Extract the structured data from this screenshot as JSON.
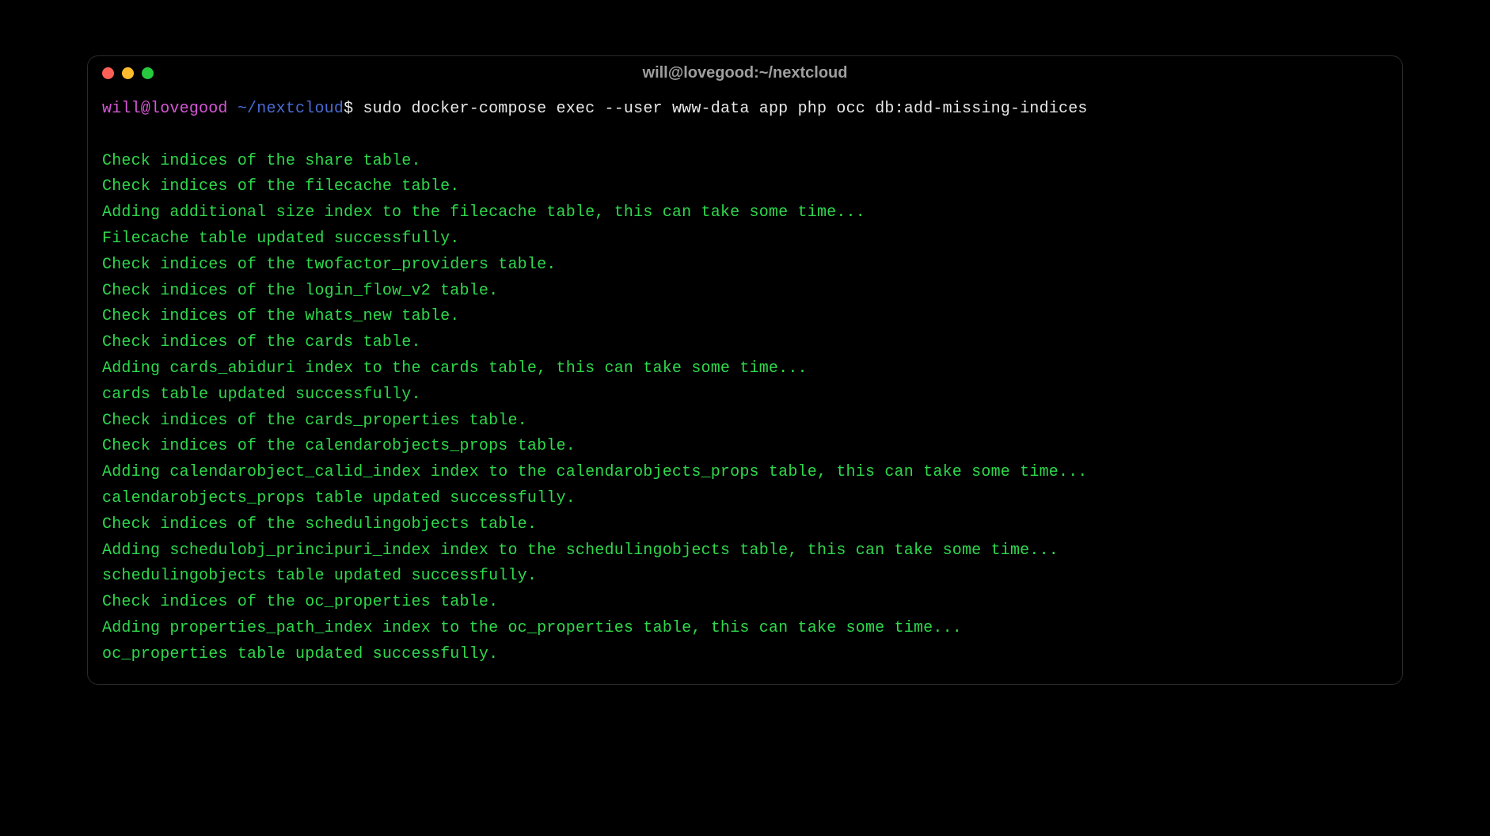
{
  "window": {
    "title": "will@lovegood:~/nextcloud"
  },
  "prompt": {
    "user": "will@lovegood",
    "path": "~/nextcloud",
    "dollar": "$",
    "command": "sudo docker-compose exec --user www-data app php occ db:add-missing-indices"
  },
  "output": [
    "Check indices of the share table.",
    "Check indices of the filecache table.",
    "Adding additional size index to the filecache table, this can take some time...",
    "Filecache table updated successfully.",
    "Check indices of the twofactor_providers table.",
    "Check indices of the login_flow_v2 table.",
    "Check indices of the whats_new table.",
    "Check indices of the cards table.",
    "Adding cards_abiduri index to the cards table, this can take some time...",
    "cards table updated successfully.",
    "Check indices of the cards_properties table.",
    "Check indices of the calendarobjects_props table.",
    "Adding calendarobject_calid_index index to the calendarobjects_props table, this can take some time...",
    "calendarobjects_props table updated successfully.",
    "Check indices of the schedulingobjects table.",
    "Adding schedulobj_principuri_index index to the schedulingobjects table, this can take some time...",
    "schedulingobjects table updated successfully.",
    "Check indices of the oc_properties table.",
    "Adding properties_path_index index to the oc_properties table, this can take some time...",
    "oc_properties table updated successfully."
  ]
}
